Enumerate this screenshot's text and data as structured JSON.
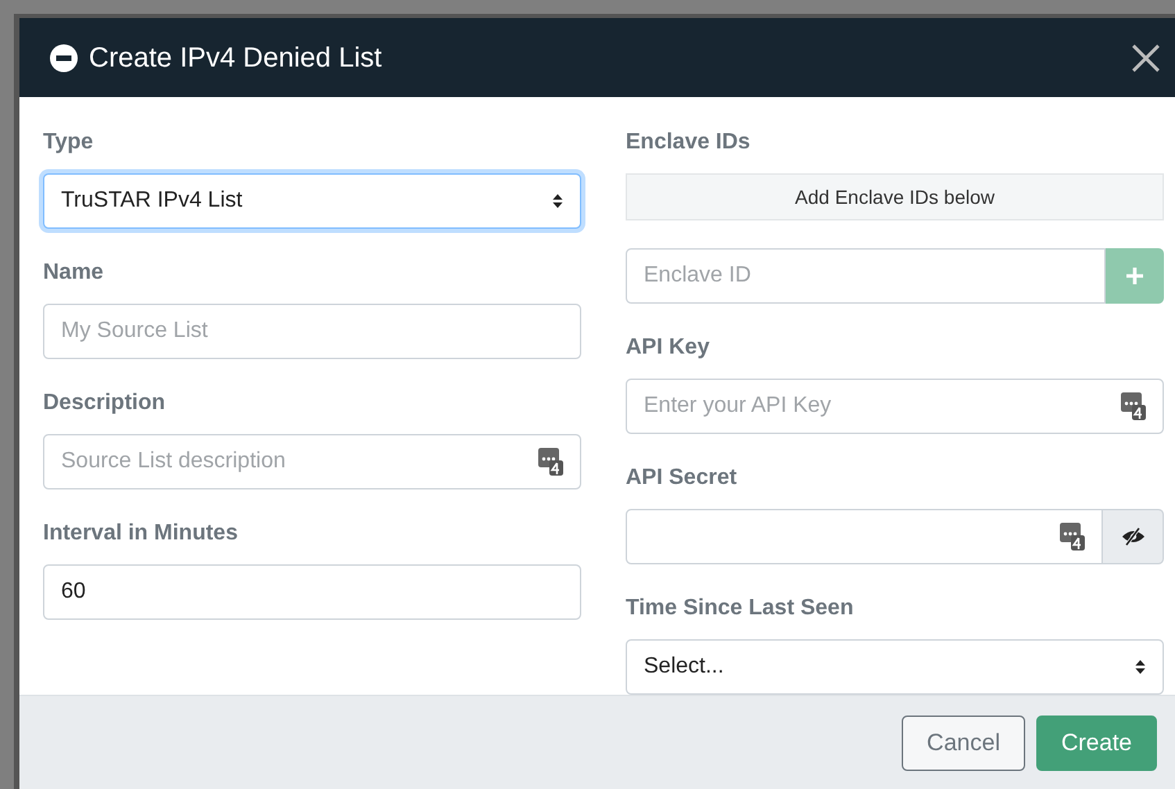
{
  "dialog": {
    "title": "Create IPv4 Denied List"
  },
  "left_fields": [
    {
      "kind": "select",
      "label": "Type",
      "value": "TruSTAR IPv4 List",
      "focused": true
    },
    {
      "kind": "input",
      "label": "Name",
      "placeholder": "My Source List"
    },
    {
      "kind": "input",
      "label": "Description",
      "placeholder": "Source List description",
      "password_manager": true
    },
    {
      "kind": "input",
      "label": "Interval in Minutes",
      "value": "60"
    }
  ],
  "right_fields": [
    {
      "kind": "banner",
      "label": "Enclave IDs",
      "text": "Add Enclave IDs below"
    },
    {
      "kind": "add",
      "placeholder": "Enclave ID",
      "disabled": true
    },
    {
      "kind": "input",
      "label": "API Key",
      "placeholder": "Enter your API Key",
      "password_manager": true
    },
    {
      "kind": "secret",
      "label": "API Secret",
      "password_manager": true
    },
    {
      "kind": "select",
      "label": "Time Since Last Seen",
      "value": "Select...",
      "focused": false
    }
  ],
  "buttons": [
    {
      "label": "Cancel",
      "kind": "secondary"
    },
    {
      "label": "Create",
      "kind": "primary"
    }
  ]
}
